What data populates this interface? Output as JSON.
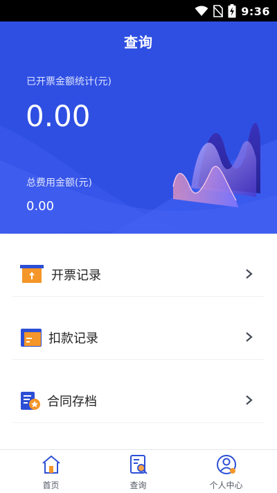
{
  "status_bar": {
    "time": "9:36",
    "icons": [
      "wifi-icon",
      "no-sim-icon",
      "battery-charging-icon"
    ]
  },
  "header": {
    "title": "查询"
  },
  "summary": {
    "issued_label": "已开票金额统计(元)",
    "issued_value": "0.00",
    "fee_label": "总费用金额(元)",
    "fee_value": "0.00"
  },
  "menu": {
    "items": [
      {
        "label": "开票记录",
        "icon": "invoice-box-icon"
      },
      {
        "label": "扣款记录",
        "icon": "wallet-card-icon"
      },
      {
        "label": "合同存档",
        "icon": "contract-archive-icon"
      }
    ]
  },
  "tabbar": {
    "tabs": [
      {
        "label": "首页",
        "icon": "home-icon"
      },
      {
        "label": "查询",
        "icon": "query-document-icon"
      },
      {
        "label": "个人中心",
        "icon": "profile-icon"
      }
    ]
  },
  "colors": {
    "hero_blue": "#2f4fe3",
    "accent_orange": "#f4962a",
    "icon_blue": "#2c4ed6"
  }
}
